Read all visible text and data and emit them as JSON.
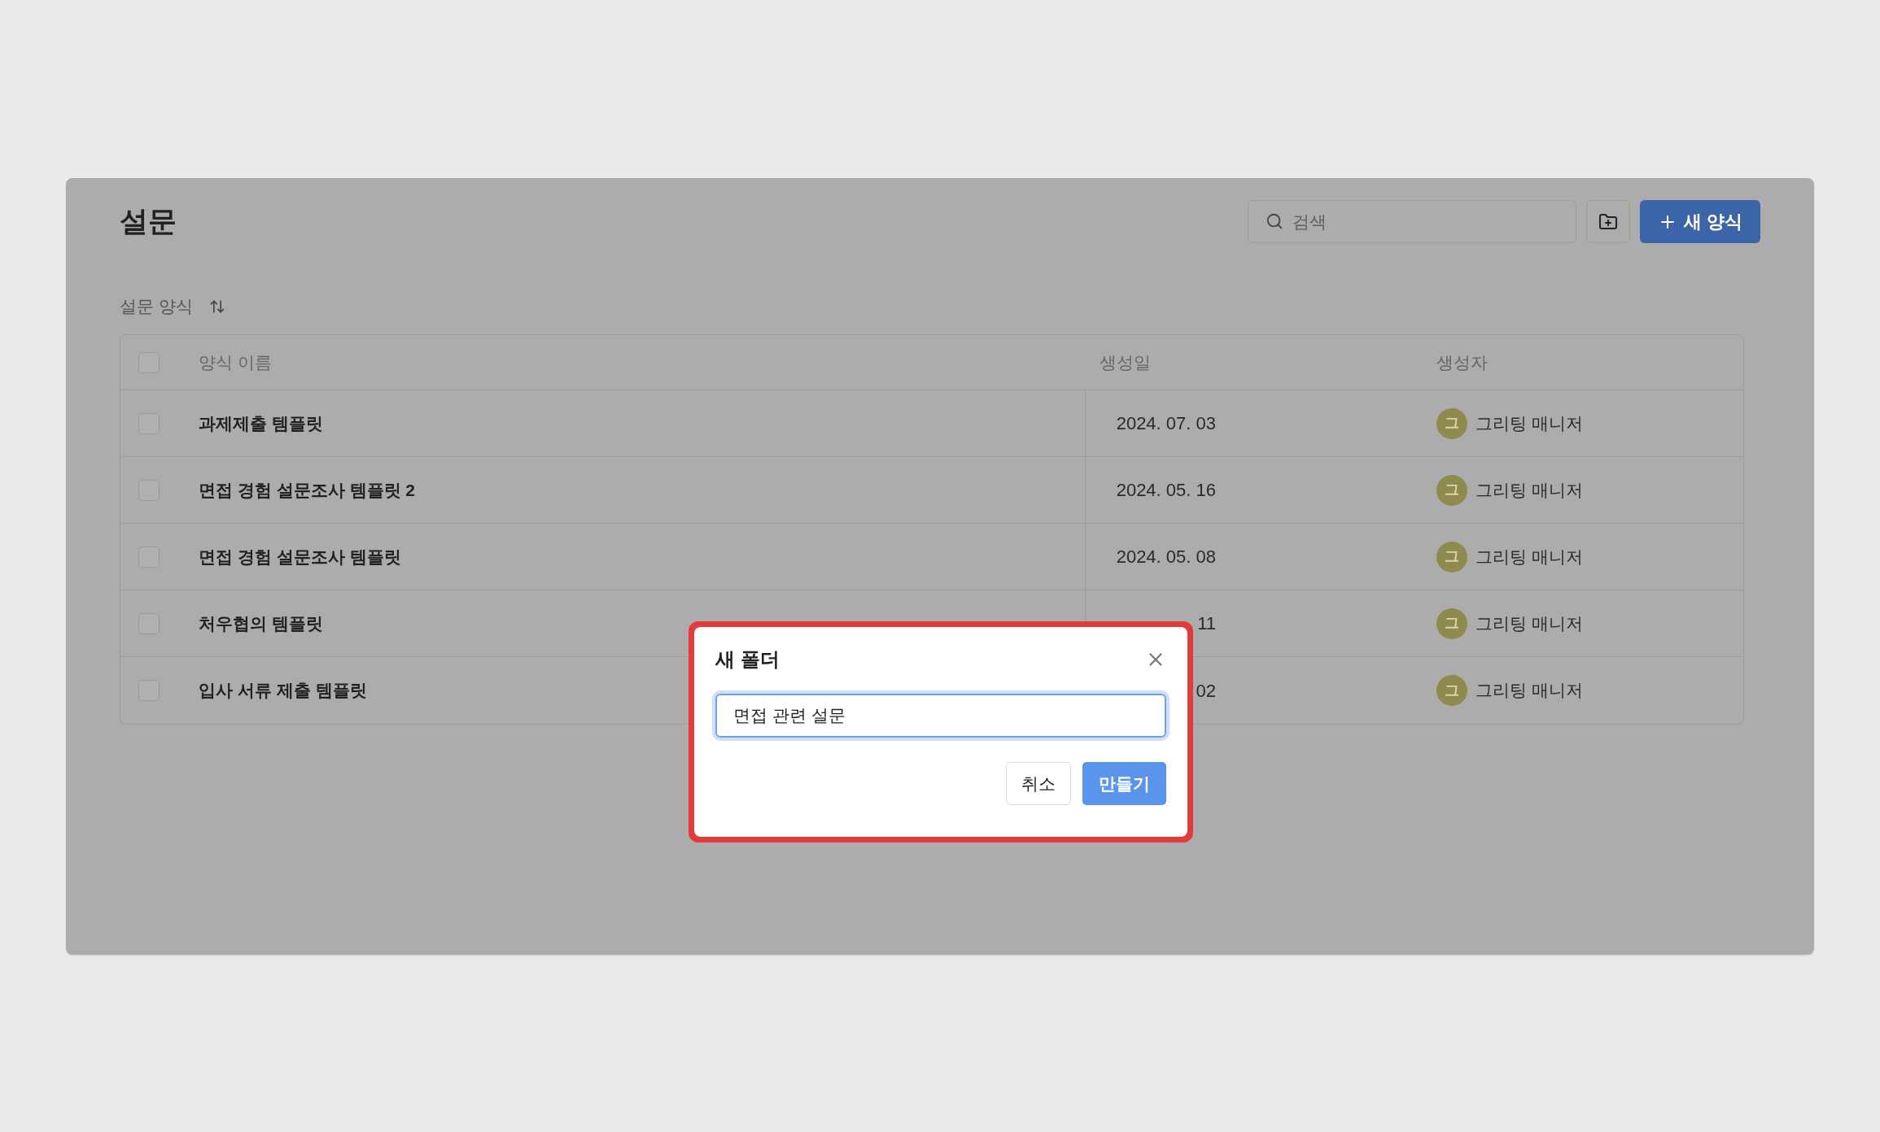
{
  "page": {
    "title": "설문"
  },
  "search": {
    "placeholder": "검색"
  },
  "new_button": {
    "label": "새 양식"
  },
  "section": {
    "label": "설문 양식"
  },
  "table": {
    "columns": [
      "양식 이름",
      "생성일",
      "생성자"
    ],
    "header_checked": false,
    "rows": [
      {
        "checked": false,
        "name": "과제제출 템플릿",
        "date": "2024. 07. 03",
        "avatar": "그",
        "creator": "그리팅 매니저"
      },
      {
        "checked": false,
        "name": "면접 경험 설문조사 템플릿 2",
        "date": "2024. 05. 16",
        "avatar": "그",
        "creator": "그리팅 매니저"
      },
      {
        "checked": false,
        "name": "면접 경험 설문조사 템플릿",
        "date": "2024. 05. 08",
        "avatar": "그",
        "creator": "그리팅 매니저"
      },
      {
        "checked": false,
        "name": "처우협의 템플릿",
        "date": "11",
        "avatar": "그",
        "creator": "그리팅 매니저"
      },
      {
        "checked": false,
        "name": "입사 서류 제출 템플릿",
        "date": "02",
        "avatar": "그",
        "creator": "그리팅 매니저"
      }
    ]
  },
  "dialog": {
    "title": "새 폴더",
    "value": "면접 관련 설문",
    "highlighted": true,
    "buttons": [
      {
        "kind": "secondary",
        "label": "취소"
      },
      {
        "kind": "primary",
        "label": "만들기"
      }
    ]
  }
}
